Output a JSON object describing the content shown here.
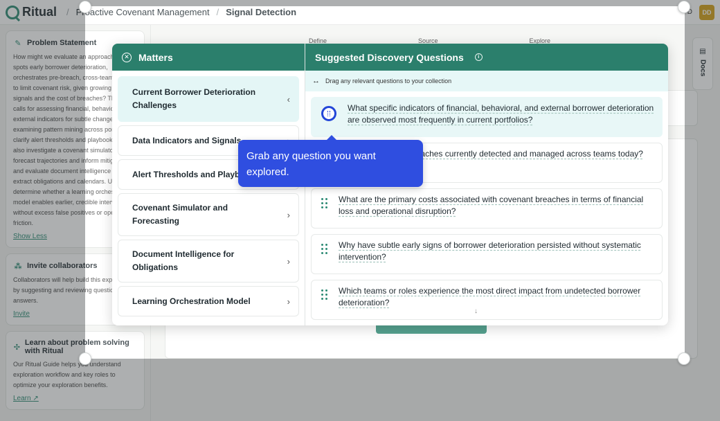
{
  "app": {
    "name": "Ritual",
    "breadcrumbs": [
      "Proactive Covenant Management",
      "Signal Detection"
    ],
    "topbar_small": "D",
    "avatar_initials": "DD"
  },
  "sidebar": {
    "problem": {
      "title": "Problem Statement",
      "text": "How might we evaluate an approach that spots early borrower deterioration, orchestrates pre-breach, cross-team actions to limit covenant risk, given growing data signals and the cost of breaches? This work calls for assessing financial, behavioral, and external indicators for subtle change and examining pattern mining across portfolios to clarify alert thresholds and playbooks. We also investigate a covenant simulator to forecast trajectories and inform mitigations, and evaluate document intelligence to extract obligations and calendars. Ultimately, determine whether a learning orchestration model enables earlier, credible interventions without excess false positives or operational friction.",
      "link": "Show Less"
    },
    "invite": {
      "title": "Invite collaborators",
      "text": "Collaborators will help build this exploration by suggesting and reviewing questions and answers.",
      "link": "Invite"
    },
    "learn": {
      "title": "Learn about problem solving with Ritual",
      "text": "Our Ritual Guide helps you understand exploration workflow and key roles to optimize your exploration benefits.",
      "link": "Learn"
    }
  },
  "steps": [
    "Define",
    "Source",
    "Explore"
  ],
  "docs_label": "Docs",
  "modal": {
    "matters_title": "Matters",
    "matters": [
      {
        "label": "Current Borrower Deterioration Challenges",
        "active": true
      },
      {
        "label": "Data Indicators and Signals",
        "active": false
      },
      {
        "label": "Alert Thresholds and Playbooks",
        "active": false
      },
      {
        "label": "Covenant Simulator and Forecasting",
        "active": false
      },
      {
        "label": "Document Intelligence for Obligations",
        "active": false
      },
      {
        "label": "Learning Orchestration Model",
        "active": false
      }
    ],
    "questions_title": "Suggested Discovery Questions",
    "drag_hint": "Drag any relevant questions to your collection",
    "questions": [
      "What specific indicators of financial, behavioral, and external borrower deterioration are observed most frequently in current portfolios?",
      "How are covenant breaches currently detected and managed across teams today?",
      "What are the primary costs associated with covenant breaches in terms of financial loss and operational disruption?",
      "Why have subtle early signs of borrower deterioration persisted without systematic intervention?",
      "Which teams or roles experience the most direct impact from undetected borrower deterioration?"
    ]
  },
  "tooltip": {
    "text": "Grab any question you want explored."
  },
  "colors": {
    "header": "#2b7f6c",
    "accent": "#2b8a73",
    "tooltip": "#2f4ee0"
  }
}
